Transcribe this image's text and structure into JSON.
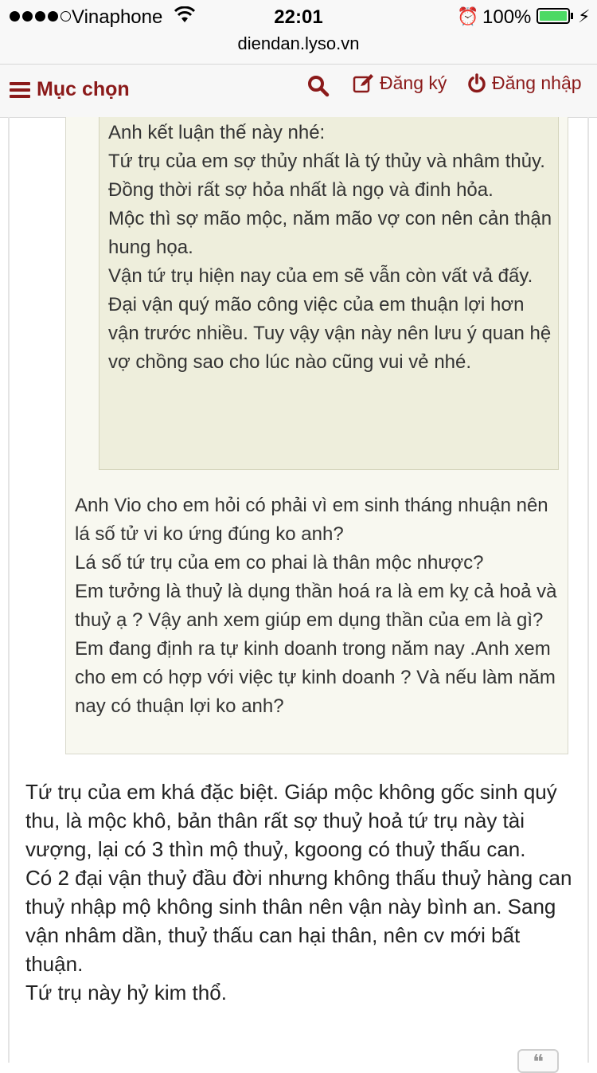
{
  "status_bar": {
    "carrier": "Vinaphone",
    "time": "22:01",
    "battery": "100%"
  },
  "url": "diendan.lyso.vn",
  "nav": {
    "menu_label": "Mục chọn",
    "register_label": "Đăng ký",
    "login_label": "Đăng nhập"
  },
  "colors": {
    "brand": "#8b1a1a",
    "quote_inner_bg": "#eeeedc",
    "quote_outer_bg": "#f8f8f0"
  },
  "post": {
    "nested_quote": "Anh kết luận thế này nhé:\nTứ trụ của em sợ thủy nhất là tý thủy và nhâm thủy. Đồng thời rất sợ hỏa nhất là ngọ và đinh hỏa.\nMộc thì sợ mão mộc, năm mão vợ con nên cản thận hung họa.\nVận tứ trụ hiện nay của em sẽ vẫn còn vất vả đấy.\nĐại vận quý mão công việc của em thuận lợi hơn vận trước nhiều. Tuy vậy vận này nên lưu ý quan hệ vợ chồng sao cho lúc nào cũng vui vẻ nhé.",
    "quote": "Anh Vio cho em hỏi có phải vì em sinh tháng nhuận nên lá số tử vi ko ứng đúng ko anh?\nLá số tứ trụ của em co phai là thân mộc nhược?\nEm tưởng là thuỷ là dụng thần hoá ra là em kỵ cả hoả và thuỷ ạ ? Vậy anh xem giúp em dụng thần của em là gì?\nEm đang định ra tự kinh doanh trong năm nay .Anh xem cho em có hợp với việc tự kinh doanh ? Và nếu làm năm nay có thuận lợi ko anh?",
    "reply": "Tứ trụ của em khá đặc biệt. Giáp mộc không gốc sinh quý thu, là mộc khô, bản thân rất sợ thuỷ hoả tứ trụ này tài vượng, lại có 3 thìn mộ thuỷ, kgoong có thuỷ thấu can.\nCó 2 đại vận thuỷ đầu đời nhưng không thấu thuỷ hàng can thuỷ nhập mộ không sinh thân nên vận này bình an. Sang vận nhâm dần, thuỷ thấu can hại thân, nên cv mới bất thuận.\nTứ trụ này hỷ kim thổ."
  }
}
